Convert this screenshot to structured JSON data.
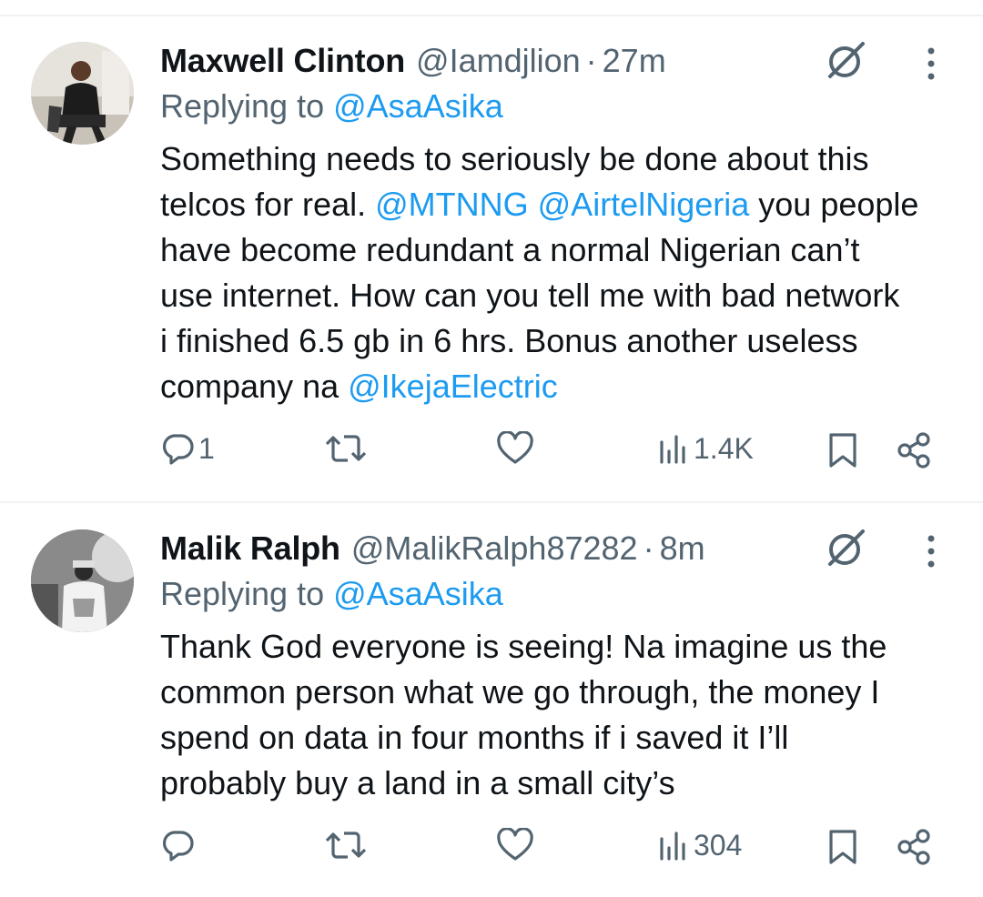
{
  "tweets": [
    {
      "name": "Maxwell Clinton",
      "handle": "@Iamdjlion",
      "dot": "·",
      "time": "27m",
      "replying_prefix": "Replying to ",
      "replying_to": "@AsaAsika",
      "body_lines": [
        [
          {
            "text": "Something needs to seriously be done about this"
          }
        ],
        [
          {
            "text": "telcos for real. "
          },
          {
            "text": "@MTNNG",
            "mention": true
          },
          {
            "text": " "
          },
          {
            "text": "@AirtelNigeria",
            "mention": true
          },
          {
            "text": " you people"
          }
        ],
        [
          {
            "text": "have become redundant a normal Nigerian can’t"
          }
        ],
        [
          {
            "text": "use internet. How can you tell me with bad network"
          }
        ],
        [
          {
            "text": "i finished 6.5 gb in 6 hrs. Bonus another useless"
          }
        ],
        [
          {
            "text": "company na "
          },
          {
            "text": "@IkejaElectric",
            "mention": true
          }
        ]
      ],
      "reply_count": "1",
      "retweet_count": "",
      "like_count": "",
      "views": "1.4K",
      "icons": [
        "avatar",
        "grok-icon",
        "more-icon",
        "reply-icon",
        "retweet-icon",
        "like-icon",
        "views-icon",
        "bookmark-icon",
        "share-icon"
      ]
    },
    {
      "name": "Malik Ralph",
      "handle": "@MalikRalph87282",
      "dot": "·",
      "time": "8m",
      "replying_prefix": "Replying to ",
      "replying_to": "@AsaAsika",
      "body_lines": [
        [
          {
            "text": "Thank God everyone is seeing! Na imagine us the"
          }
        ],
        [
          {
            "text": "common person what we go through, the money I"
          }
        ],
        [
          {
            "text": "spend on data  in four months if i saved it I’ll"
          }
        ],
        [
          {
            "text": "probably buy a land in a small city’s"
          }
        ]
      ],
      "reply_count": "",
      "retweet_count": "",
      "like_count": "",
      "views": "304",
      "icons": [
        "avatar",
        "grok-icon",
        "more-icon",
        "reply-icon",
        "retweet-icon",
        "like-icon",
        "views-icon",
        "bookmark-icon",
        "share-icon"
      ]
    }
  ],
  "colors": {
    "text": "#0f1419",
    "secondary": "#536471",
    "link": "#1d9bf0",
    "divider": "#eff3f4"
  }
}
